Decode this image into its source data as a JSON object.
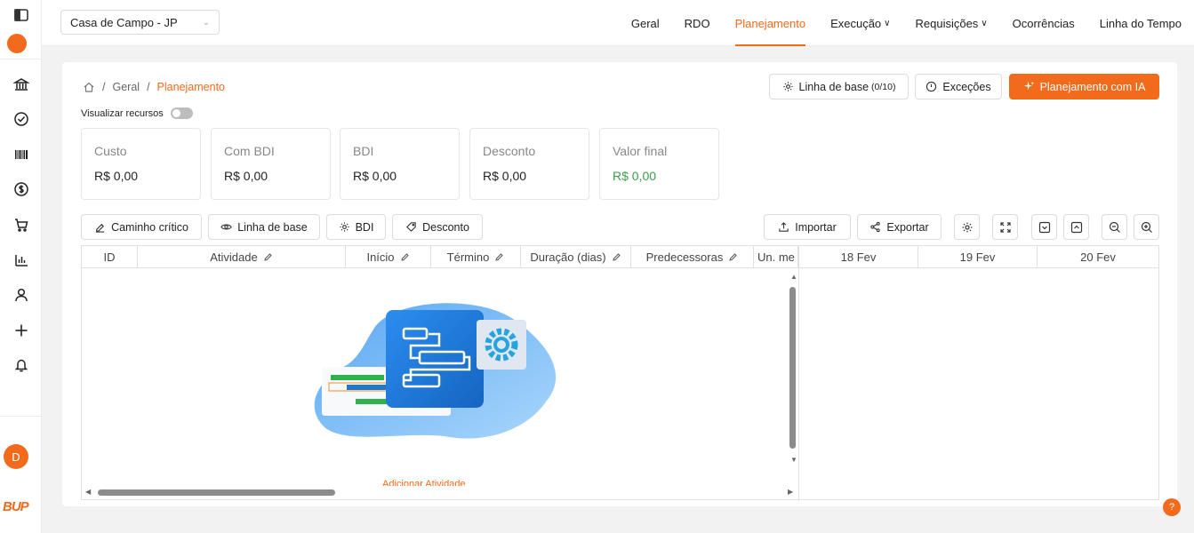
{
  "topbar": {
    "project": "Casa de Campo - JP",
    "nav": [
      {
        "label": "Geral"
      },
      {
        "label": "RDO"
      },
      {
        "label": "Planejamento"
      },
      {
        "label": "Execução"
      },
      {
        "label": "Requisições"
      },
      {
        "label": "Ocorrências"
      },
      {
        "label": "Linha do Tempo"
      }
    ],
    "active_nav": "Planejamento"
  },
  "sidebar": {
    "items": [
      "panel-toggle-icon",
      "logo-icon",
      "bank-icon",
      "check-circle-icon",
      "barcode-icon",
      "dollar-icon",
      "cart-icon",
      "bar-chart-icon",
      "user-icon",
      "plus-icon",
      "bell-icon"
    ],
    "avatar": "D",
    "brand": "BUP"
  },
  "breadcrumb": {
    "items": [
      "Geral",
      "Planejamento"
    ]
  },
  "header_buttons": {
    "baseline_label": "Linha de base",
    "baseline_count": "(0/10)",
    "exceptions": "Exceções",
    "ai_planning": "Planejamento com IA"
  },
  "resources_toggle": {
    "label": "Visualizar recursos",
    "on": false
  },
  "stats": [
    {
      "label": "Custo",
      "value": "R$ 0,00"
    },
    {
      "label": "Com BDI",
      "value": "R$ 0,00"
    },
    {
      "label": "BDI",
      "value": "R$ 0,00"
    },
    {
      "label": "Desconto",
      "value": "R$ 0,00"
    },
    {
      "label": "Valor final",
      "value": "R$ 0,00"
    }
  ],
  "toolbar": {
    "critical_path": "Caminho crítico",
    "baseline": "Linha de base",
    "bdi": "BDI",
    "discount": "Desconto",
    "import": "Importar",
    "export": "Exportar"
  },
  "grid": {
    "columns": [
      "ID",
      "Atividade",
      "Início",
      "Término",
      "Duração (dias)",
      "Predecessoras",
      "Un. me"
    ],
    "timeline": [
      "18 Fev",
      "19 Fev",
      "20 Fev"
    ],
    "empty_action": "Adicionar Atividade"
  },
  "colors": {
    "accent": "#f26a1b",
    "positive": "#3a9d4a"
  }
}
